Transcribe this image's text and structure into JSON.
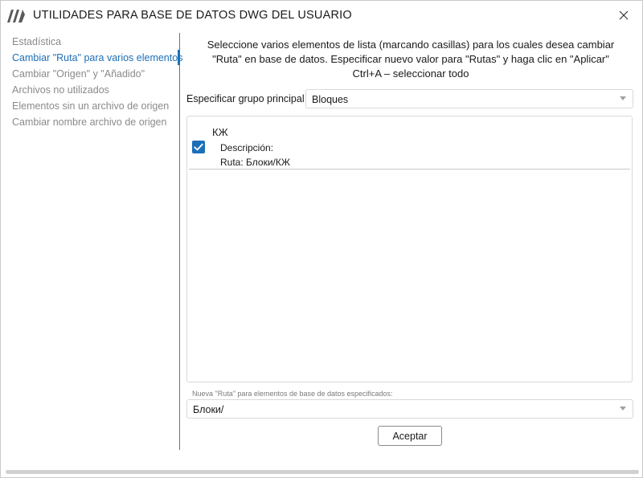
{
  "window": {
    "title": "UTILIDADES PARA BASE DE DATOS DWG DEL USUARIO"
  },
  "sidebar": {
    "items": [
      {
        "label": "Estadística",
        "active": false
      },
      {
        "label": "Cambiar \"Ruta\" para varios elementos",
        "active": true
      },
      {
        "label": "Cambiar \"Origen\" y \"Añadido\"",
        "active": false
      },
      {
        "label": "Archivos no utilizados",
        "active": false
      },
      {
        "label": "Elementos sin un archivo de origen",
        "active": false
      },
      {
        "label": "Cambiar nombre archivo de origen",
        "active": false
      }
    ]
  },
  "main": {
    "instructions": [
      "Seleccione varios elementos de lista (marcando casillas) para los cuales desea cambiar",
      "\"Ruta\" en base de datos. Especificar nuevo valor para \"Rutas\" y haga clic en \"Aplicar\"",
      "Ctrl+A – seleccionar todo"
    ],
    "group_label": "Especificar grupo principal",
    "group_value": "Bloques",
    "items": [
      {
        "name": "КЖ",
        "checked": true,
        "description": "Descripción:",
        "path": "Ruta: Блоки/КЖ"
      }
    ],
    "path_label": "Nueva \"Ruta\" para elementos de base de datos especificados:",
    "path_value": "Блоки/",
    "accept_label": "Aceptar"
  },
  "colors": {
    "accent": "#1d6fb8",
    "inactive_text": "#8a8a8a"
  }
}
